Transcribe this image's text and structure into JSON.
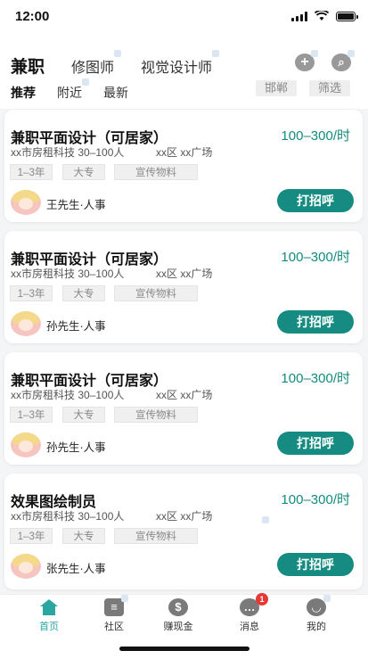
{
  "status": {
    "time": "12:00"
  },
  "tabs": [
    "兼职",
    "修图师",
    "视觉设计师"
  ],
  "subtabs": [
    "推荐",
    "附近",
    "最新"
  ],
  "filters": [
    "邯郸",
    "筛选"
  ],
  "jobs": [
    {
      "title": "兼职平面设计（可居家）",
      "salary": "100–300/时",
      "company": "xx市房租科技 30–100人",
      "location": "xx区 xx广场",
      "tags": [
        "1–3年",
        "大专",
        "宣传物料"
      ],
      "contact": "王先生·人事",
      "button": "打招呼"
    },
    {
      "title": "兼职平面设计（可居家）",
      "salary": "100–300/时",
      "company": "xx市房租科技 30–100人",
      "location": "xx区 xx广场",
      "tags": [
        "1–3年",
        "大专",
        "宣传物料"
      ],
      "contact": "孙先生·人事",
      "button": "打招呼"
    },
    {
      "title": "兼职平面设计（可居家）",
      "salary": "100–300/时",
      "company": "xx市房租科技 30–100人",
      "location": "xx区 xx广场",
      "tags": [
        "1–3年",
        "大专",
        "宣传物料"
      ],
      "contact": "孙先生·人事",
      "button": "打招呼"
    },
    {
      "title": "效果图绘制员",
      "salary": "100–300/时",
      "company": "xx市房租科技 30–100人",
      "location": "xx区 xx广场",
      "tags": [
        "1–3年",
        "大专",
        "宣传物料"
      ],
      "contact": "张先生·人事",
      "button": "打招呼"
    }
  ],
  "tabbar": [
    {
      "label": "首页",
      "icon": "home-icon"
    },
    {
      "label": "社区",
      "icon": "community-icon"
    },
    {
      "label": "赚现金",
      "icon": "dollar-icon"
    },
    {
      "label": "消息",
      "icon": "message-icon",
      "badge": "1"
    },
    {
      "label": "我的",
      "icon": "profile-icon"
    }
  ],
  "colors": {
    "accent": "#168b81",
    "salary": "#138a7d",
    "active_tab": "#2aa7a0",
    "badge": "#e53935"
  }
}
